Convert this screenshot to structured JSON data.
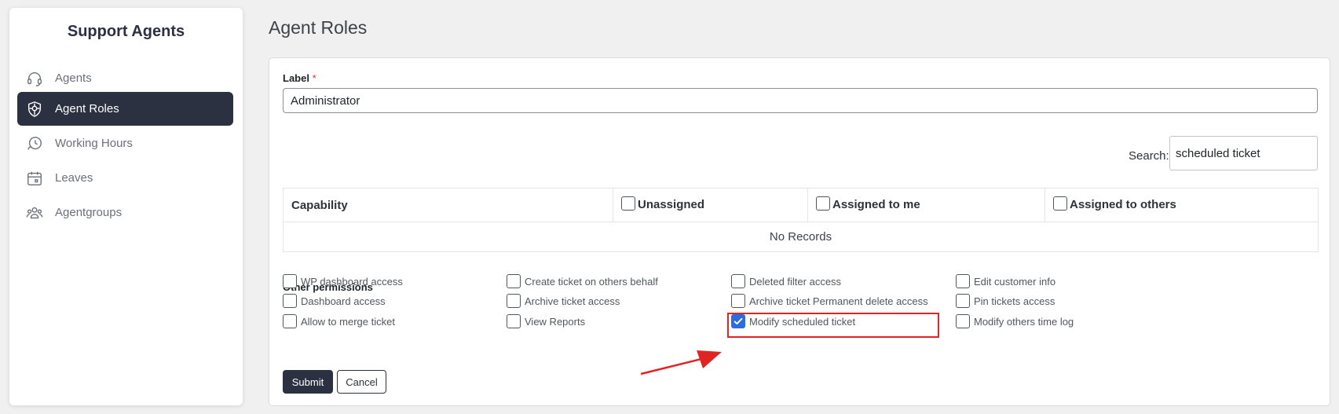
{
  "sidebar": {
    "title": "Support Agents",
    "items": [
      {
        "label": "Agents",
        "icon": "headset-icon",
        "active": false
      },
      {
        "label": "Agent Roles",
        "icon": "shield-icon",
        "active": true
      },
      {
        "label": "Working Hours",
        "icon": "clock-icon",
        "active": false
      },
      {
        "label": "Leaves",
        "icon": "calendar-icon",
        "active": false
      },
      {
        "label": "Agentgroups",
        "icon": "group-icon",
        "active": false
      }
    ]
  },
  "page": {
    "title": "Agent Roles"
  },
  "form": {
    "label_text": "Label",
    "required_mark": "*",
    "label_value": "Administrator",
    "search_label": "Search:",
    "search_value": "scheduled ticket"
  },
  "table": {
    "headers": [
      "Capability",
      "Unassigned",
      "Assigned to me",
      "Assigned to others"
    ],
    "empty_text": "No Records"
  },
  "permissions": {
    "title": "Other permissions",
    "items": [
      {
        "label": "WP dashboard access",
        "checked": false
      },
      {
        "label": "Create ticket on others behalf",
        "checked": false
      },
      {
        "label": "Deleted filter access",
        "checked": false
      },
      {
        "label": "Edit customer info",
        "checked": false
      },
      {
        "label": "Dashboard access",
        "checked": false
      },
      {
        "label": "Archive ticket access",
        "checked": false
      },
      {
        "label": "Archive ticket Permanent delete access",
        "checked": false
      },
      {
        "label": "Pin tickets access",
        "checked": false
      },
      {
        "label": "Allow to merge ticket",
        "checked": false
      },
      {
        "label": "View Reports",
        "checked": false
      },
      {
        "label": "Modify scheduled ticket",
        "checked": true
      },
      {
        "label": "Modify others time log",
        "checked": false
      }
    ]
  },
  "buttons": {
    "submit": "Submit",
    "cancel": "Cancel"
  },
  "colors": {
    "accent": "#2c3142",
    "checkbox": "#2d6cdf",
    "annotation": "#e02424"
  }
}
